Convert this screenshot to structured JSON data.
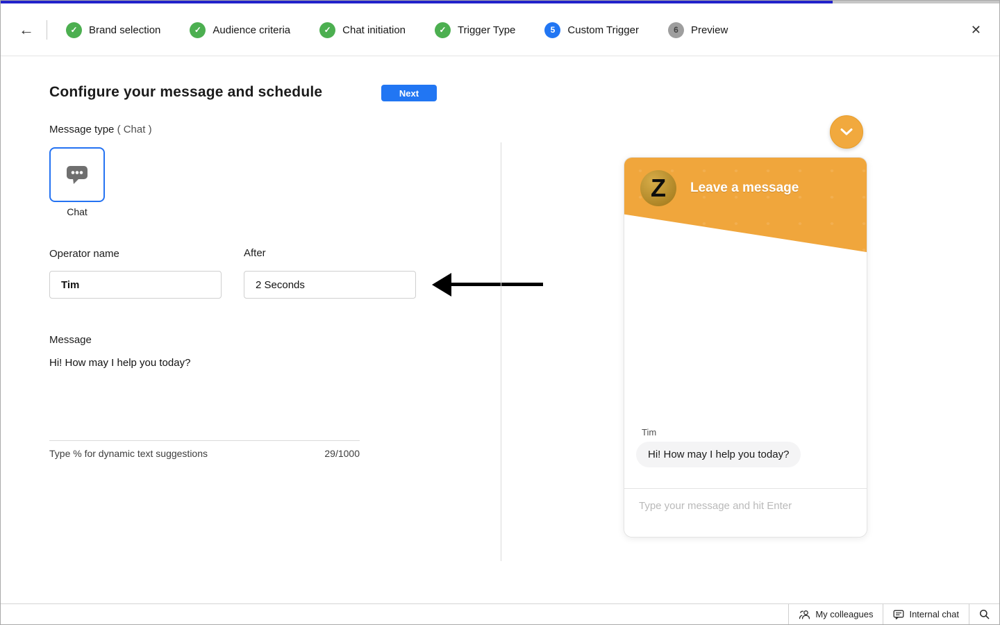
{
  "window": {
    "progress_fraction": "83.3%",
    "back_icon": "←",
    "close_icon": "✕"
  },
  "stepper": {
    "steps": [
      {
        "label": "Brand selection",
        "glyph": "✓",
        "status": "done"
      },
      {
        "label": "Audience criteria",
        "glyph": "✓",
        "status": "done"
      },
      {
        "label": "Chat initiation",
        "glyph": "✓",
        "status": "done"
      },
      {
        "label": "Trigger Type",
        "glyph": "✓",
        "status": "done"
      },
      {
        "label": "Custom Trigger",
        "glyph": "5",
        "status": "current"
      },
      {
        "label": "Preview",
        "glyph": "6",
        "status": "upcoming"
      }
    ]
  },
  "form": {
    "title": "Configure your message and schedule",
    "next_label": "Next",
    "message_type_label": "Message type",
    "message_type_value": "( Chat )",
    "chat_card_label": "Chat",
    "operator_name_label": "Operator name",
    "operator_name_value": "Tim",
    "after_label": "After",
    "after_value": "2 Seconds",
    "message_label": "Message",
    "message_value": "Hi! How may I help you today?",
    "hint": "Type % for dynamic text suggestions",
    "char_count": "29/1000"
  },
  "preview": {
    "header_title": "Leave a message",
    "avatar_letter": "Z",
    "operator_name": "Tim",
    "message": "Hi! How may I help you today?",
    "input_placeholder": "Type your message and hit Enter"
  },
  "statusbar": {
    "my_colleagues_label": "My colleagues",
    "internal_chat_label": "Internal chat"
  },
  "colors": {
    "accent_blue": "#2176f3",
    "progress_blue": "#2323cb",
    "step_green": "#4caf50",
    "widget_orange": "#f0a63c"
  }
}
